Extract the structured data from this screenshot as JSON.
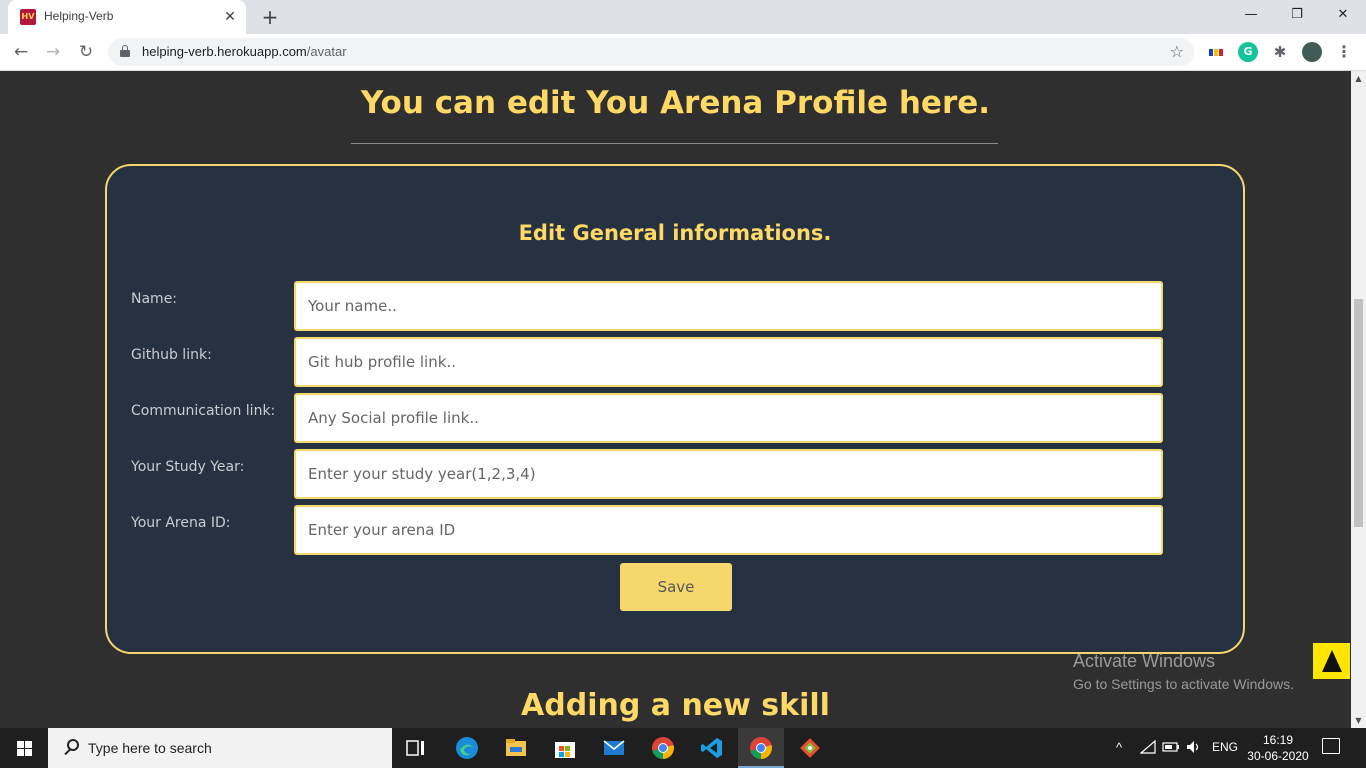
{
  "browser": {
    "tab_title": "Helping-Verb",
    "tab_favicon": "HV",
    "tab_close": "✕",
    "new_tab": "+",
    "url_host": "helping-verb.herokuapp.com",
    "url_path": "/avatar",
    "ext_grammarly": "G"
  },
  "page": {
    "title": "You can edit You Arena Profile here.",
    "card_heading": "Edit General informations.",
    "fields": [
      {
        "label": "Name:",
        "placeholder": "Your name.."
      },
      {
        "label": "Github link:",
        "placeholder": "Git hub profile link.."
      },
      {
        "label": "Communication link:",
        "placeholder": "Any Social profile link.."
      },
      {
        "label": "Your Study Year:",
        "placeholder": "Enter your study year(1,2,3,4)"
      },
      {
        "label": "Your Arena ID:",
        "placeholder": "Enter your arena ID"
      }
    ],
    "save_label": "Save",
    "section_title": "Adding a new skill"
  },
  "watermark": {
    "title": "Activate Windows",
    "subtitle": "Go to Settings to activate Windows."
  },
  "taskbar": {
    "search_placeholder": "Type here to search",
    "language": "ENG",
    "time": "16:19",
    "date": "30-06-2020"
  },
  "colors": {
    "accent": "#ffd866",
    "border": "#f5d76e",
    "card_bg": "#263242",
    "page_bg": "#2f2f2f"
  }
}
